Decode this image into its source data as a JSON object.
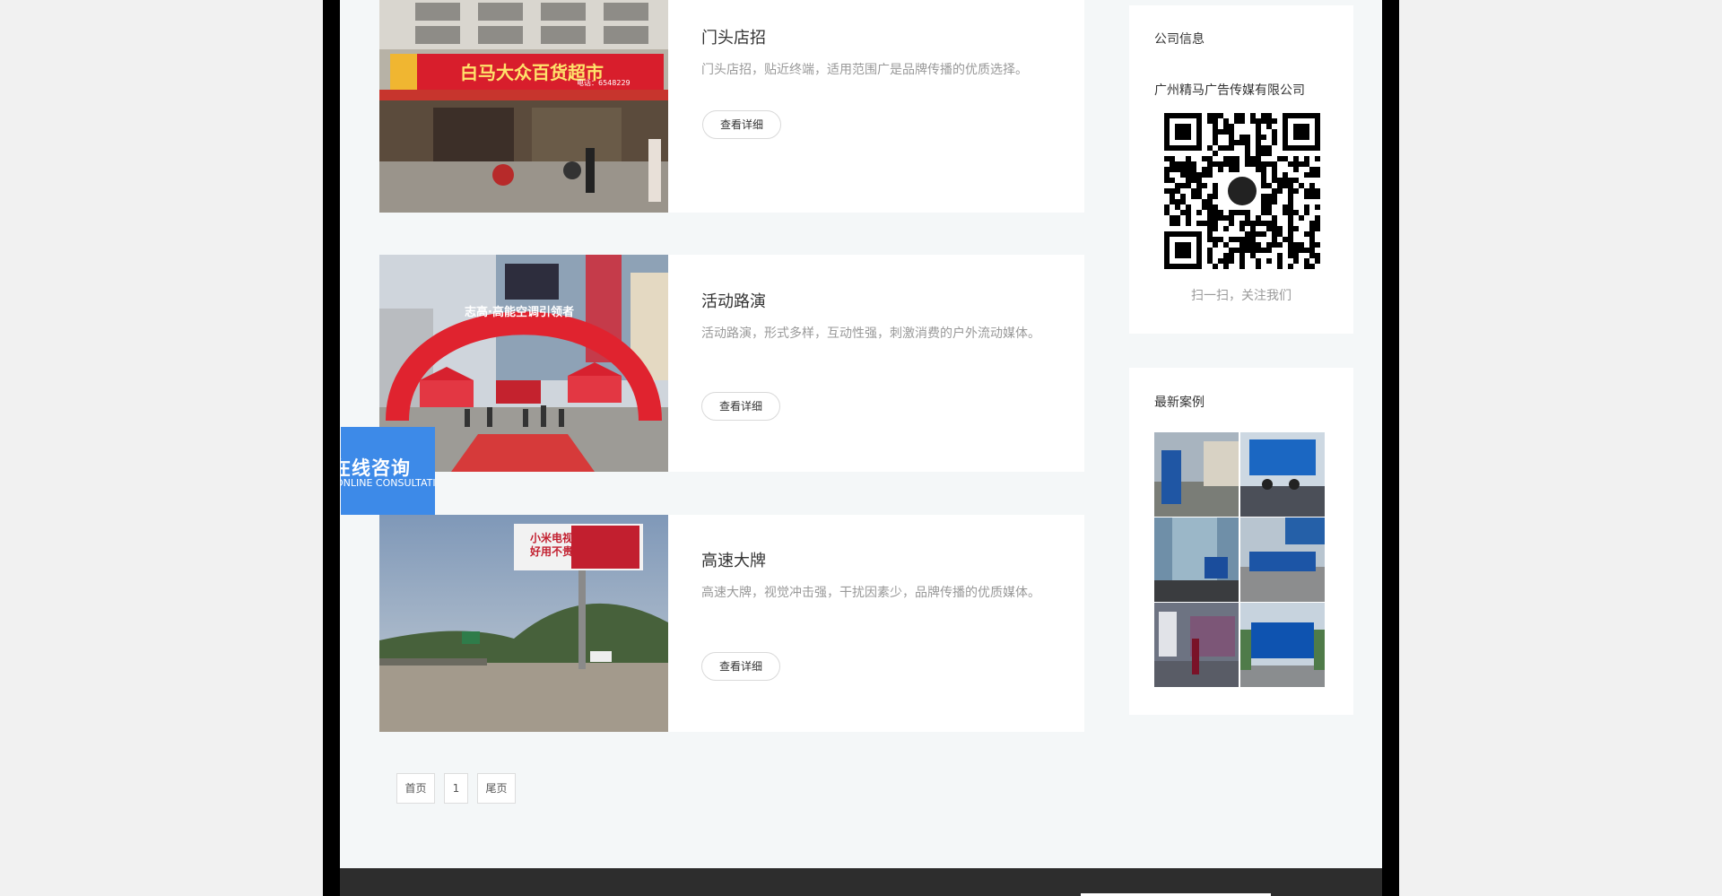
{
  "products": [
    {
      "title": "门头店招",
      "desc": "门头店招，贴近终端，适用范围广是品牌传播的优质选择。",
      "button": "查看详细",
      "image": {
        "sign_text": "白马大众百货超市",
        "phone_text": "电话：6548229"
      }
    },
    {
      "title": "活动路演",
      "desc": "活动路演，形式多样，互动性强，刺激消费的户外流动媒体。",
      "button": "查看详细",
      "image": {
        "arch_text": "志高·高能空调引领者"
      }
    },
    {
      "title": "高速大牌",
      "desc": "高速大牌，视觉冲击强，干扰因素少，品牌传播的优质媒体。",
      "button": "查看详细",
      "image": {
        "billboard_line1": "小米电视",
        "billboard_line2": "好用不贵"
      }
    }
  ],
  "sidebar": {
    "company_info": {
      "title": "公司信息",
      "company_name": "广州精马广告传媒有限公司",
      "qr_caption": "扫一扫，关注我们"
    },
    "latest_cases": {
      "title": "最新案例"
    }
  },
  "pagination": {
    "first": "首页",
    "current": "1",
    "last": "尾页"
  },
  "consult": {
    "label_cn": "在线咨询",
    "label_en": "ONLINE CONSULTATION"
  },
  "colors": {
    "accent_blue": "#3d8ae8",
    "page_bg": "#f4f7f8",
    "frame": "#000000",
    "footer": "#2d2d2d"
  }
}
